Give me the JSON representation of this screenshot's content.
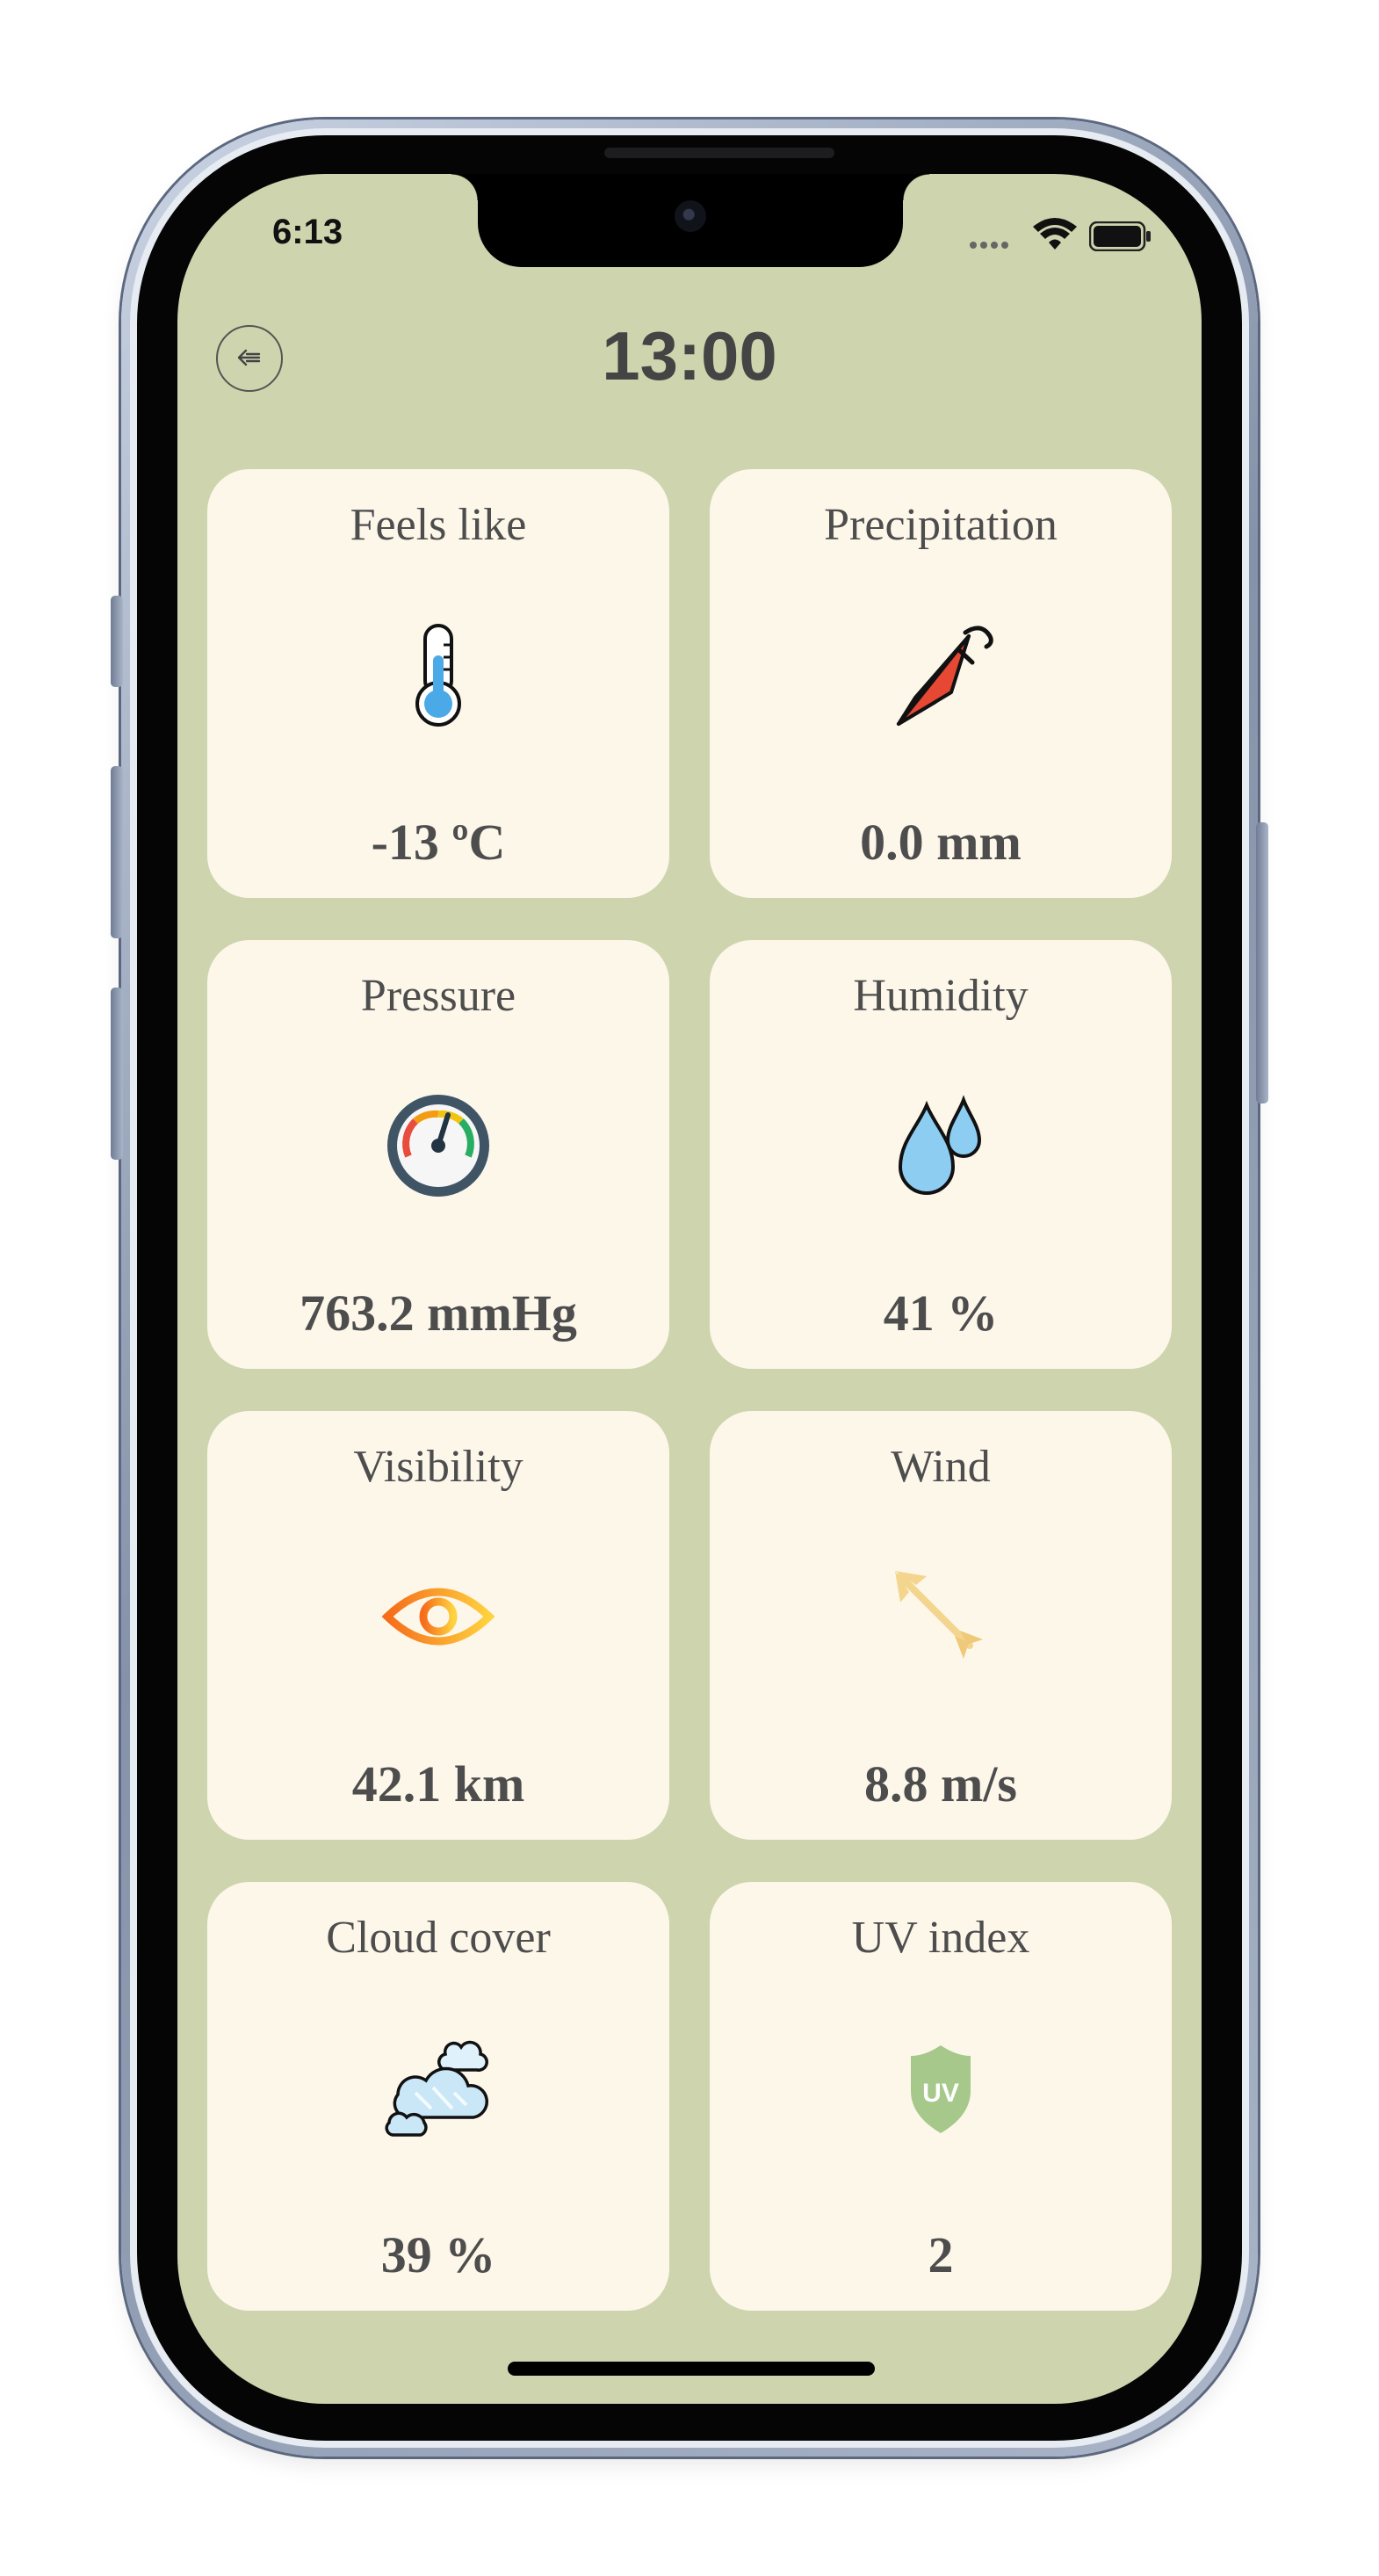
{
  "status_bar": {
    "time": "6:13",
    "icons": [
      "signal-dots-icon",
      "wifi-icon",
      "battery-icon"
    ]
  },
  "header": {
    "title": "13:00",
    "back_icon": "back-arrow-icon"
  },
  "cards": [
    {
      "label": "Feels like",
      "value": "-13 ºC",
      "icon": "thermometer-icon"
    },
    {
      "label": "Precipitation",
      "value": "0.0 mm",
      "icon": "umbrella-icon"
    },
    {
      "label": "Pressure",
      "value": "763.2 mmHg",
      "icon": "pressure-gauge-icon"
    },
    {
      "label": "Humidity",
      "value": "41 %",
      "icon": "water-drops-icon"
    },
    {
      "label": "Visibility",
      "value": "42.1 km",
      "icon": "eye-icon"
    },
    {
      "label": "Wind",
      "value": "8.8 m/s",
      "icon": "wind-direction-arrow-icon"
    },
    {
      "label": "Cloud cover",
      "value": "39 %",
      "icon": "clouds-icon"
    },
    {
      "label": "UV index",
      "value": "2",
      "icon": "uv-shield-icon",
      "icon_text": "UV"
    }
  ],
  "colors": {
    "screen_background": "#ced5ae",
    "card_background": "#fdf7ea",
    "text": "#4d4d4d"
  }
}
